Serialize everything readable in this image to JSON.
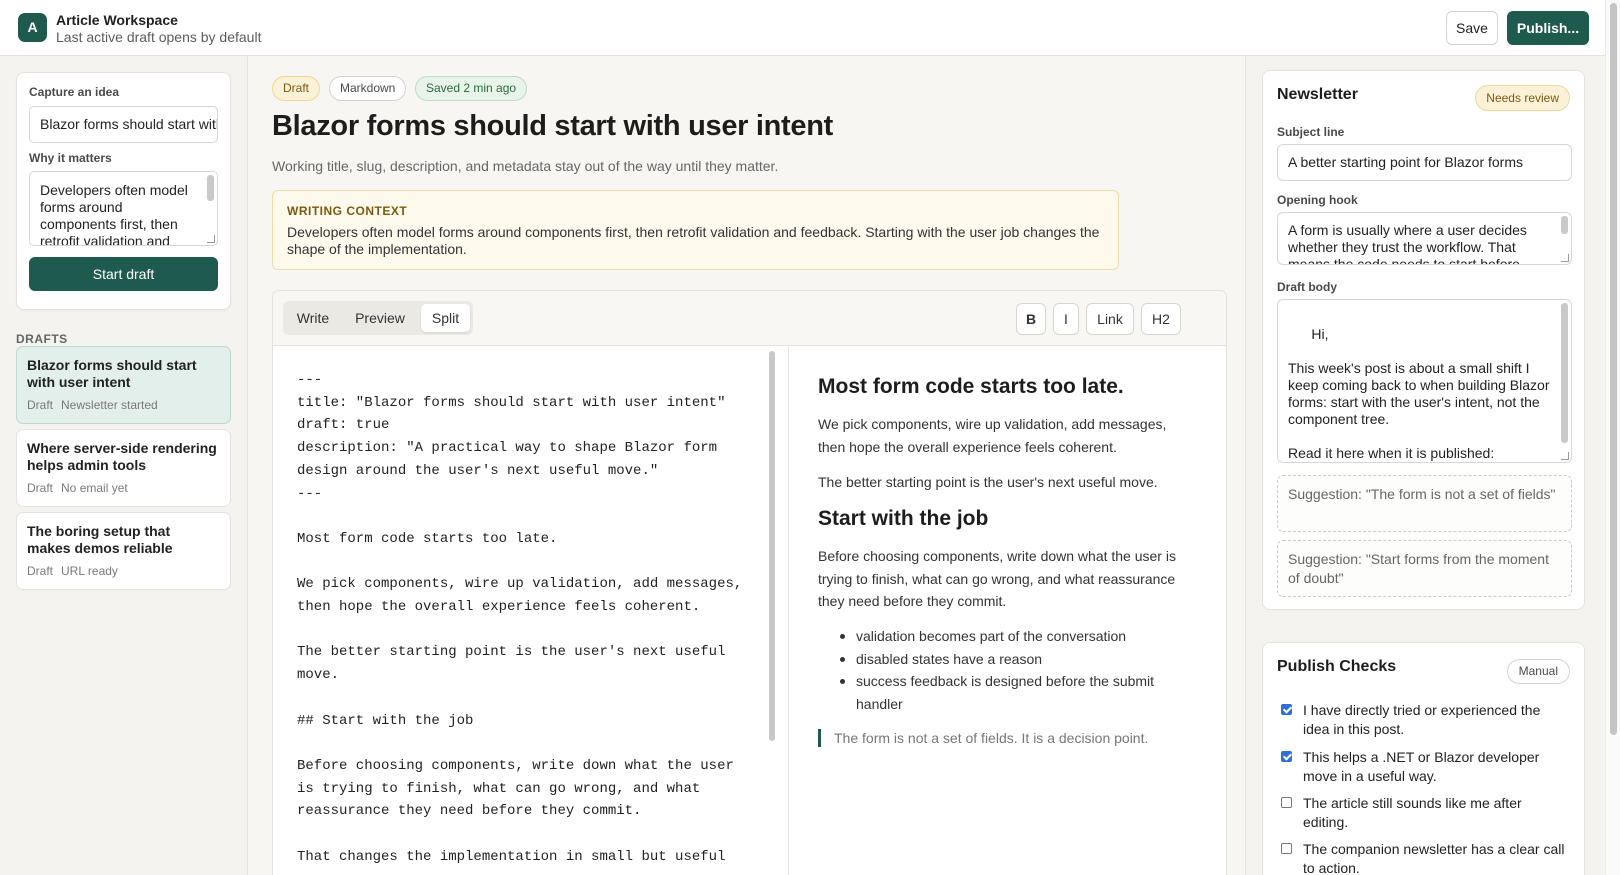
{
  "header": {
    "logo_letter": "A",
    "title": "Article Workspace",
    "subtitle": "Last active draft opens by default",
    "save_label": "Save",
    "publish_label": "Publish..."
  },
  "sidebar": {
    "capture_title": "Capture an idea",
    "idea_value": "Blazor forms should start with user intent",
    "why_label": "Why it matters",
    "why_value": "Developers often model forms around components first, then retrofit validation and",
    "start_label": "Start draft",
    "drafts_heading": "DRAFTS",
    "drafts": [
      {
        "title": "Blazor forms should start with user intent",
        "status": "Draft",
        "meta": "Newsletter started",
        "active": true
      },
      {
        "title": "Where server-side rendering helps admin tools",
        "status": "Draft",
        "meta": "No email yet",
        "active": false
      },
      {
        "title": "The boring setup that makes demos reliable",
        "status": "Draft",
        "meta": "URL ready",
        "active": false
      }
    ]
  },
  "main": {
    "pills": {
      "draft": "Draft",
      "format": "Markdown",
      "saved": "Saved 2 min ago"
    },
    "title": "Blazor forms should start with user intent",
    "subtitle": "Working title, slug, description, and metadata stay out of the way until they matter.",
    "context_label": "WRITING CONTEXT",
    "context_text": "Developers often model forms around components first, then retrofit validation and feedback. Starting with the user job changes the shape of the implementation.",
    "tabs": [
      "Write",
      "Preview",
      "Split"
    ],
    "active_tab": "Split",
    "format_buttons": {
      "bold": "B",
      "italic": "I",
      "link": "Link",
      "h2": "H2"
    },
    "source": "---\ntitle: \"Blazor forms should start with user intent\"\ndraft: true\ndescription: \"A practical way to shape Blazor form\ndesign around the user's next useful move.\"\n---\n\nMost form code starts too late.\n\nWe pick components, wire up validation, add messages,\nthen hope the overall experience feels coherent.\n\nThe better starting point is the user's next useful\nmove.\n\n## Start with the job\n\nBefore choosing components, write down what the user\nis trying to finish, what can go wrong, and what\nreassurance they need before they commit.\n\nThat changes the implementation in small but useful",
    "preview": {
      "h1": "Most form code starts too late.",
      "p1": "We pick components, wire up validation, add messages, then hope the overall experience feels coherent.",
      "p2": "The better starting point is the user's next useful move.",
      "h2": "Start with the job",
      "p3": "Before choosing components, write down what the user is trying to finish, what can go wrong, and what reassurance they need before they commit.",
      "bullets": [
        "validation becomes part of the conversation",
        "disabled states have a reason",
        "success feedback is designed before the submit handler"
      ],
      "quote": "The form is not a set of fields. It is a decision point."
    }
  },
  "newsletter": {
    "title": "Newsletter",
    "badge": "Needs review",
    "subject_label": "Subject line",
    "subject_value": "A better starting point for Blazor forms",
    "hook_label": "Opening hook",
    "hook_value": "A form is usually where a user decides whether they trust the workflow. That means the code needs to start before",
    "body_label": "Draft body",
    "body_value": "Hi,\n\nThis week's post is about a small shift I keep coming back to when building Blazor forms: start with the user's intent, not the component tree.\n\nRead it here when it is published:\n[final article URL]",
    "suggestions": [
      "Suggestion: \"The form is not a set of fields\"",
      "Suggestion: \"Start forms from the moment of doubt\""
    ]
  },
  "checks": {
    "title": "Publish Checks",
    "badge": "Manual",
    "items": [
      {
        "label": "I have directly tried or experienced the idea in this post.",
        "checked": true
      },
      {
        "label": "This helps a .NET or Blazor developer move in a useful way.",
        "checked": true
      },
      {
        "label": "The article still sounds like me after editing.",
        "checked": false
      },
      {
        "label": "The companion newsletter has a clear call to action.",
        "checked": false
      }
    ]
  },
  "colors": {
    "accent": "#1f5a4f",
    "warning_bg": "#fbf1d6",
    "success_bg": "#e8f3ea"
  }
}
